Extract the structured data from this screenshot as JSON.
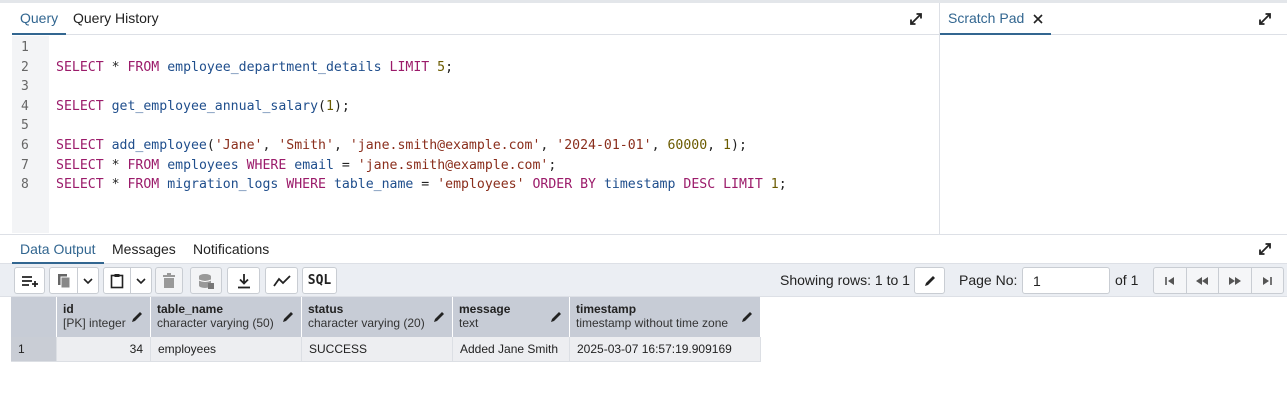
{
  "query_panel": {
    "tabs": [
      {
        "label": "Query",
        "active": true
      },
      {
        "label": "Query History",
        "active": false
      }
    ],
    "line_numbers": [
      "1",
      "2",
      "3",
      "4",
      "5",
      "6",
      "7",
      "8"
    ]
  },
  "scratch_pad": {
    "tab_label": "Scratch Pad"
  },
  "output_panel": {
    "tabs": [
      {
        "label": "Data Output",
        "active": true
      },
      {
        "label": "Messages",
        "active": false
      },
      {
        "label": "Notifications",
        "active": false
      }
    ],
    "toolbar": {
      "sql_button_label": "SQL",
      "showing_rows_text": "Showing rows: 1 to 1",
      "page_no_label": "Page No:",
      "page_no_value": "1",
      "of_pages_text": "of 1"
    },
    "grid": {
      "columns": [
        {
          "name": "id",
          "type": "[PK] integer"
        },
        {
          "name": "table_name",
          "type": "character varying (50)"
        },
        {
          "name": "status",
          "type": "character varying (20)"
        },
        {
          "name": "message",
          "type": "text"
        },
        {
          "name": "timestamp",
          "type": "timestamp without time zone"
        }
      ],
      "rows": [
        {
          "row_number": "1",
          "cells": [
            "34",
            "employees",
            "SUCCESS",
            "Added Jane Smith",
            "2025-03-07 16:57:19.909169"
          ]
        }
      ]
    }
  },
  "colors": {
    "accent": "#326690",
    "keyword": "#9b1b6a",
    "identifier": "#1f4e8c",
    "string": "#8a2e1c",
    "number": "#6b5b00",
    "grid_header": "#c7ccd6"
  }
}
